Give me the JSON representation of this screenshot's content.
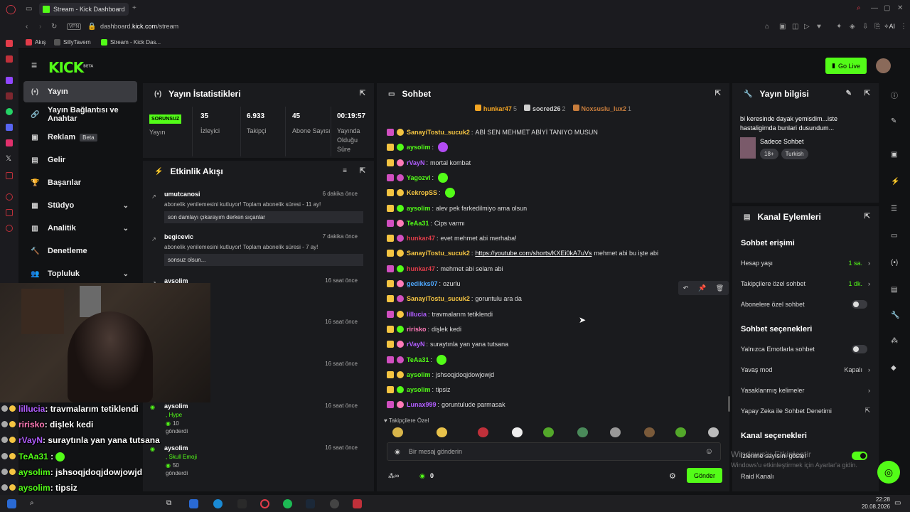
{
  "browser": {
    "tab_title": "Stream - Kick Dashboard",
    "url_prefix": "dashboard.",
    "url_host": "kick.com",
    "url_path": "/stream",
    "vpn": "VPN",
    "ai": "AI",
    "bookmarks": [
      "Akış",
      "SillyTavern",
      "Stream - Kick Das..."
    ]
  },
  "header": {
    "logo": "KICK",
    "logo_sup": "BETA",
    "go_live": "Go Live"
  },
  "nav": [
    {
      "label": "Yayın",
      "icon": "(•)"
    },
    {
      "label": "Yayın Bağlantısı ve Anahtar",
      "icon": "🔗"
    },
    {
      "label": "Reklam",
      "icon": "▣",
      "badge": "Beta"
    },
    {
      "label": "Gelir",
      "icon": "▤"
    },
    {
      "label": "Başarılar",
      "icon": "🏆"
    },
    {
      "label": "Stüdyo",
      "icon": "▦",
      "chev": "⌄"
    },
    {
      "label": "Analitik",
      "icon": "▥",
      "chev": "⌄"
    },
    {
      "label": "Denetleme",
      "icon": "🔨"
    },
    {
      "label": "Topluluk",
      "icon": "👥",
      "chev": "⌄"
    }
  ],
  "stats": {
    "title": "Yayın İstatistikleri",
    "status": "SORUNSUZ",
    "status_label": "Yayın",
    "items": [
      {
        "v": "35",
        "l": "İzleyici"
      },
      {
        "v": "6.933",
        "l": "Takipçi"
      },
      {
        "v": "45",
        "l": "Abone Sayısı"
      },
      {
        "v": "00:19:57",
        "l": "Yayında Olduğu Süre"
      }
    ]
  },
  "activity": {
    "title": "Etkinlik Akışı",
    "events": [
      {
        "user": "umutcanosi",
        "time": "6 dakika önce",
        "msg": "abonelik yenilemesini kutluyor! Toplam abonelik süresi - 11 ay!",
        "quote": "son damlayı çıkarayım derken sıçanlar"
      },
      {
        "user": "begicevic",
        "time": "7 dakika önce",
        "msg": "abonelik yenilemesini kutluyor! Toplam abonelik süresi - 7 ay!",
        "quote": "sonsuz olsun..."
      },
      {
        "user": "aysolim",
        "time": "16 saat önce"
      },
      {
        "user": "",
        "time": "16 saat önce"
      },
      {
        "user": "",
        "time": "16 saat önce"
      },
      {
        "user": "aysolim",
        "time": "16 saat önce",
        "gift": ", Hype",
        "amount": "10",
        "sent": "gönderdi"
      },
      {
        "user": "aysolim",
        "time": "16 saat önce",
        "gift": ", Skull Emoji",
        "amount": "50",
        "sent": "gönderdi"
      }
    ]
  },
  "chat": {
    "title": "Sohbet",
    "top": [
      {
        "name": "hunkar47",
        "n": "5",
        "c": "#f5a623"
      },
      {
        "name": "socred26",
        "n": "2",
        "c": "#cfcfcf"
      },
      {
        "name": "Noxsuslu_lux2",
        "n": "1",
        "c": "#c87d3c"
      }
    ],
    "messages": [
      {
        "name": "SanayiTostu_sucuk2",
        "color": "#f5c542",
        "text": "ABİ SEN MEHMET ABİYİ TANIYO MUSUN"
      },
      {
        "name": "aysolim",
        "color": "#53fc18",
        "text": "",
        "emote": "#b24bf3"
      },
      {
        "name": "rVayN",
        "color": "#b15dff",
        "text": "mortal kombat"
      },
      {
        "name": "Yagozvl",
        "color": "#53fc18",
        "text": "",
        "emote": "#53fc18"
      },
      {
        "name": "KekropSS",
        "color": "#f5c542",
        "text": "",
        "emote": "#53fc18"
      },
      {
        "name": "aysolim",
        "color": "#53fc18",
        "text": "alev pek farkedilmiyo ama olsun"
      },
      {
        "name": "TeAa31",
        "color": "#53fc18",
        "text": "Cips varmı"
      },
      {
        "name": "hunkar47",
        "color": "#e23c4a",
        "text": "evet mehmet abi merhaba!"
      },
      {
        "name": "SanayiTostu_sucuk2",
        "color": "#f5c542",
        "link": "https://youtube.com/shorts/KXEi0kA7uVs",
        "text": "mehmet abi bu işte abi"
      },
      {
        "name": "hunkar47",
        "color": "#e23c4a",
        "text": "mehmet abi selam abi"
      },
      {
        "name": "gedikks07",
        "color": "#4fa8ff",
        "text": "ozurlu"
      },
      {
        "name": "SanayiTostu_sucuk2",
        "color": "#f5c542",
        "text": "goruntulu ara da"
      },
      {
        "name": "lillucia",
        "color": "#b15dff",
        "text": "travmalarım tetiklendi"
      },
      {
        "name": "ririsko",
        "color": "#ff7ab8",
        "text": "dişlek kedi"
      },
      {
        "name": "rVayN",
        "color": "#b15dff",
        "text": "suraytınla yan yana tutsana"
      },
      {
        "name": "TeAa31",
        "color": "#53fc18",
        "text": "",
        "emote": "#53fc18"
      },
      {
        "name": "aysolim",
        "color": "#53fc18",
        "text": "jshsoqjdoqjdowjowjd"
      },
      {
        "name": "aysolim",
        "color": "#53fc18",
        "text": "tipsiz"
      },
      {
        "name": "Lunax999",
        "color": "#b15dff",
        "text": "goruntulude parmasak"
      }
    ],
    "follower_label": "Takipçilere Özel",
    "placeholder": "Bir mesaj gönderin",
    "points": "0",
    "send": "Gönder"
  },
  "info": {
    "title": "Yayın bilgisi",
    "desc": "bi keresinde dayak yemisdim...iste hastaligimda bunlari dusundum...",
    "category": "Sadece Sohbet",
    "tags": [
      "18+",
      "Turkish"
    ]
  },
  "actions": {
    "title": "Kanal Eylemleri",
    "chat_access": "Sohbet erişimi",
    "rows1": [
      {
        "l": "Hesap yaşı",
        "v": "1 sa.",
        "green": true
      },
      {
        "l": "Takipçilere özel sohbet",
        "v": "1 dk.",
        "green": true
      },
      {
        "l": "Abonelere özel sohbet",
        "toggle": false
      }
    ],
    "chat_opts": "Sohbet seçenekleri",
    "rows2": [
      {
        "l": "Yalnızca Emotlarla sohbet",
        "toggle": false
      },
      {
        "l": "Yavaş mod",
        "v": "Kapalı"
      },
      {
        "l": "Yasaklanmış kelimeler",
        "v": ""
      },
      {
        "l": "Yapay Zeka ile Sohbet Denetimi",
        "ext": true
      }
    ],
    "channel_opts": "Kanal seçenekleri",
    "rows3": [
      {
        "l": "İzlenme sayısını göster",
        "toggle": true
      },
      {
        "l": "Raid Kanalı"
      }
    ]
  },
  "overlay": [
    {
      "name": "lillucia",
      "color": "#b15dff",
      "text": ": travmalarım tetiklendi"
    },
    {
      "name": "ririsko",
      "color": "#ff7ab8",
      "text": ": dişlek kedi"
    },
    {
      "name": "rVayN",
      "color": "#b15dff",
      "text": ": suraytınla yan yana tutsana"
    },
    {
      "name": "TeAa31",
      "color": "#53fc18",
      "text": " : "
    },
    {
      "name": "aysolim",
      "color": "#53fc18",
      "text": ": jshsoqjdoqjdowjowjd"
    },
    {
      "name": "aysolim",
      "color": "#53fc18",
      "text": ": tipsiz"
    },
    {
      "name": "Lunax999",
      "color": "#b15dff",
      "text": ": goruntulude parmasak"
    }
  ],
  "windows": {
    "watermark": "Windows'u Etkinleştir",
    "watermark2": "Windows'u etkinleştirmek için Ayarlar'a gidin.",
    "time": "22:28",
    "date": "20.08.2026"
  }
}
